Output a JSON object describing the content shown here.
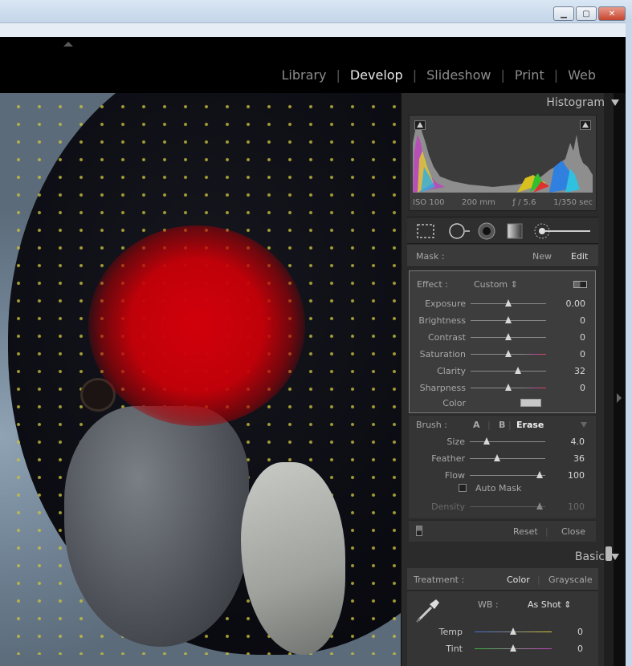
{
  "modules": {
    "items": [
      {
        "label": "Library",
        "active": false
      },
      {
        "label": "Develop",
        "active": true
      },
      {
        "label": "Slideshow",
        "active": false
      },
      {
        "label": "Print",
        "active": false
      },
      {
        "label": "Web",
        "active": false
      }
    ]
  },
  "histogram": {
    "header": "Histogram",
    "exif": {
      "iso": "ISO 100",
      "focal": "200 mm",
      "aperture": "ƒ / 5.6",
      "shutter": "1/350 sec"
    }
  },
  "mask": {
    "label": "Mask :",
    "new_label": "New",
    "edit_label": "Edit"
  },
  "effect": {
    "label": "Effect :",
    "preset": "Custom ⇕",
    "sliders": [
      {
        "name": "Exposure",
        "value": "0.00",
        "pos": 0.5
      },
      {
        "name": "Brightness",
        "value": "0",
        "pos": 0.5
      },
      {
        "name": "Contrast",
        "value": "0",
        "pos": 0.5
      },
      {
        "name": "Saturation",
        "value": "0",
        "pos": 0.5
      },
      {
        "name": "Clarity",
        "value": "32",
        "pos": 0.63
      },
      {
        "name": "Sharpness",
        "value": "0",
        "pos": 0.5
      }
    ],
    "color_label": "Color"
  },
  "brush": {
    "label": "Brush :",
    "a_label": "A",
    "b_label": "B",
    "erase_label": "Erase",
    "sliders": [
      {
        "name": "Size",
        "value": "4.0",
        "pos": 0.22
      },
      {
        "name": "Feather",
        "value": "36",
        "pos": 0.36
      },
      {
        "name": "Flow",
        "value": "100",
        "pos": 0.93
      }
    ],
    "auto_mask_label": "Auto Mask",
    "density": {
      "name": "Density",
      "value": "100",
      "pos": 0.93
    }
  },
  "footer": {
    "reset_label": "Reset",
    "close_label": "Close"
  },
  "basic": {
    "header": "Basic",
    "treatment_label": "Treatment :",
    "color_label": "Color",
    "grayscale_label": "Grayscale",
    "wb_label": "WB :",
    "wb_value": "As Shot ⇕",
    "temp": {
      "name": "Temp",
      "value": "0",
      "pos": 0.5
    },
    "tint": {
      "name": "Tint",
      "value": "0",
      "pos": 0.5
    }
  }
}
